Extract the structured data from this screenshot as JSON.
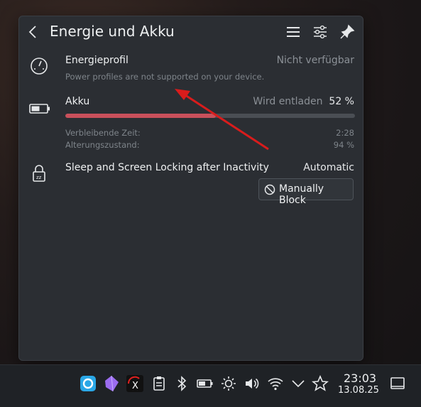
{
  "popup": {
    "title": "Energie und Akku",
    "header_icons": [
      "back-icon",
      "menu-icon",
      "configure-icon",
      "pin-icon"
    ]
  },
  "energy_profile": {
    "label": "Energieprofil",
    "status": "Nicht verfügbar",
    "description": "Power profiles are not supported on your device.",
    "icon": "speedometer-icon"
  },
  "battery": {
    "label": "Akku",
    "status": "Wird entladen",
    "percent_text": "52 %",
    "percent": 52,
    "remaining_label": "Verbleibende Zeit:",
    "remaining_value": "2:28",
    "health_label": "Alterungszustand:",
    "health_value": "94 %",
    "icon": "battery-icon"
  },
  "sleep": {
    "label": "Sleep and Screen Locking after Inactivity",
    "status": "Automatic",
    "button_label": "Manually Block",
    "icon": "lock-sleep-icon"
  },
  "taskbar": {
    "time": "23:03",
    "date": "13.08.25",
    "tray_icons": [
      "app-launcher-icon",
      "obsidian-icon",
      "x-app-icon",
      "clipboard-icon",
      "bluetooth-icon",
      "battery-icon",
      "brightness-icon",
      "volume-icon",
      "wifi-icon",
      "chevron-down-icon",
      "star-icon",
      "show-desktop-icon"
    ]
  },
  "colors": {
    "accent": "#c9505b",
    "annotation_arrow": "#d91c1c",
    "panel_bg": "#2b2e33"
  }
}
